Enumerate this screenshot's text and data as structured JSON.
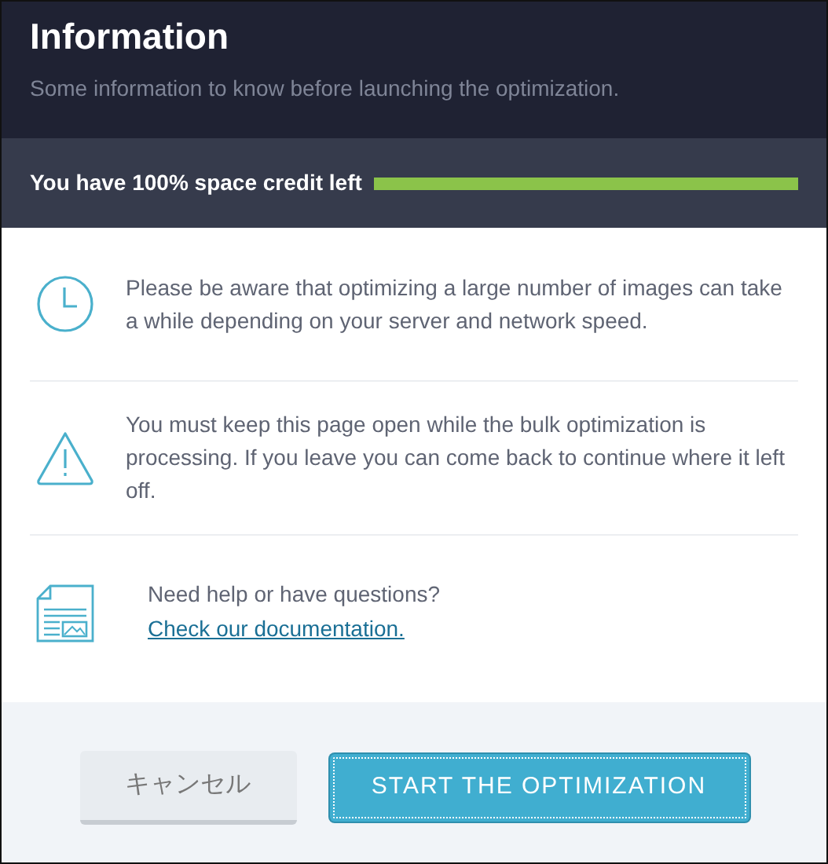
{
  "header": {
    "title": "Information",
    "subtitle": "Some information to know before launching the optimization."
  },
  "credit": {
    "label": "You have 100% space credit left"
  },
  "notices": [
    {
      "kind": "clock",
      "text": "Please be aware that optimizing a large number of images can take a while depending on your server and network speed."
    },
    {
      "kind": "warning",
      "text": "You must keep this page open while the bulk optimization is processing. If you leave you can come back to continue where it left off."
    },
    {
      "kind": "document",
      "text": "Need help or have questions?",
      "link": "Check our documentation."
    }
  ],
  "buttons": [
    {
      "kind": "secondary",
      "label": "キャンセル",
      "focused": false
    },
    {
      "kind": "primary",
      "label": "START THE OPTIMIZATION",
      "focused": true
    }
  ]
}
